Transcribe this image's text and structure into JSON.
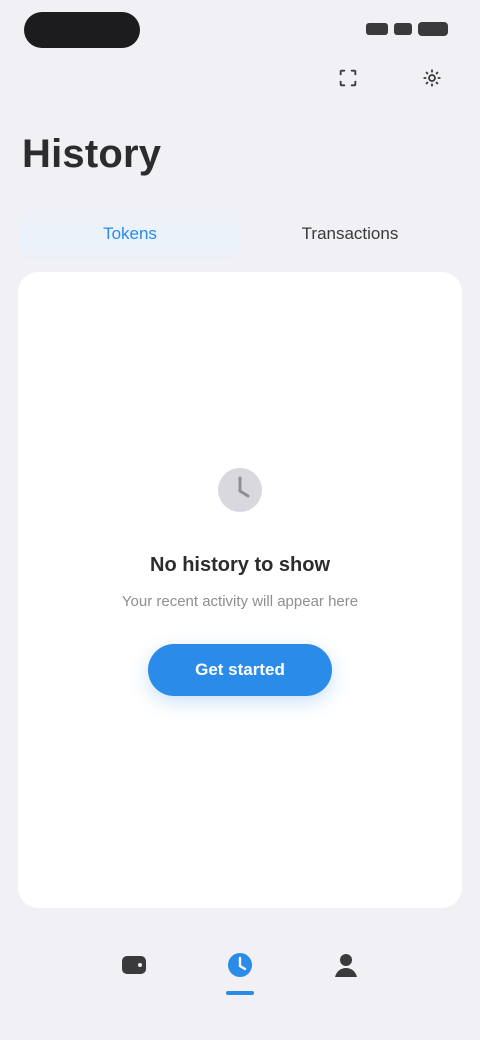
{
  "header": {
    "title": "History"
  },
  "tabs": [
    {
      "label": "Tokens",
      "active": true
    },
    {
      "label": "Transactions",
      "active": false
    }
  ],
  "empty_state": {
    "title": "No history to show",
    "subtitle": "Your recent activity will appear here",
    "button_label": "Get started"
  },
  "icons": {
    "status": [
      "signal-icon",
      "wifi-icon",
      "battery-icon"
    ],
    "top_actions": [
      "scan-icon",
      "settings-icon"
    ],
    "empty": "clock-icon",
    "bottom_nav": [
      "wallet-icon",
      "history-icon",
      "profile-icon"
    ]
  },
  "colors": {
    "accent": "#2b8be8",
    "background": "#f0f0f5",
    "card": "#ffffff",
    "title": "#2c2c2e",
    "muted": "#8e8e93"
  },
  "bottom_nav": {
    "active_index": 1
  }
}
